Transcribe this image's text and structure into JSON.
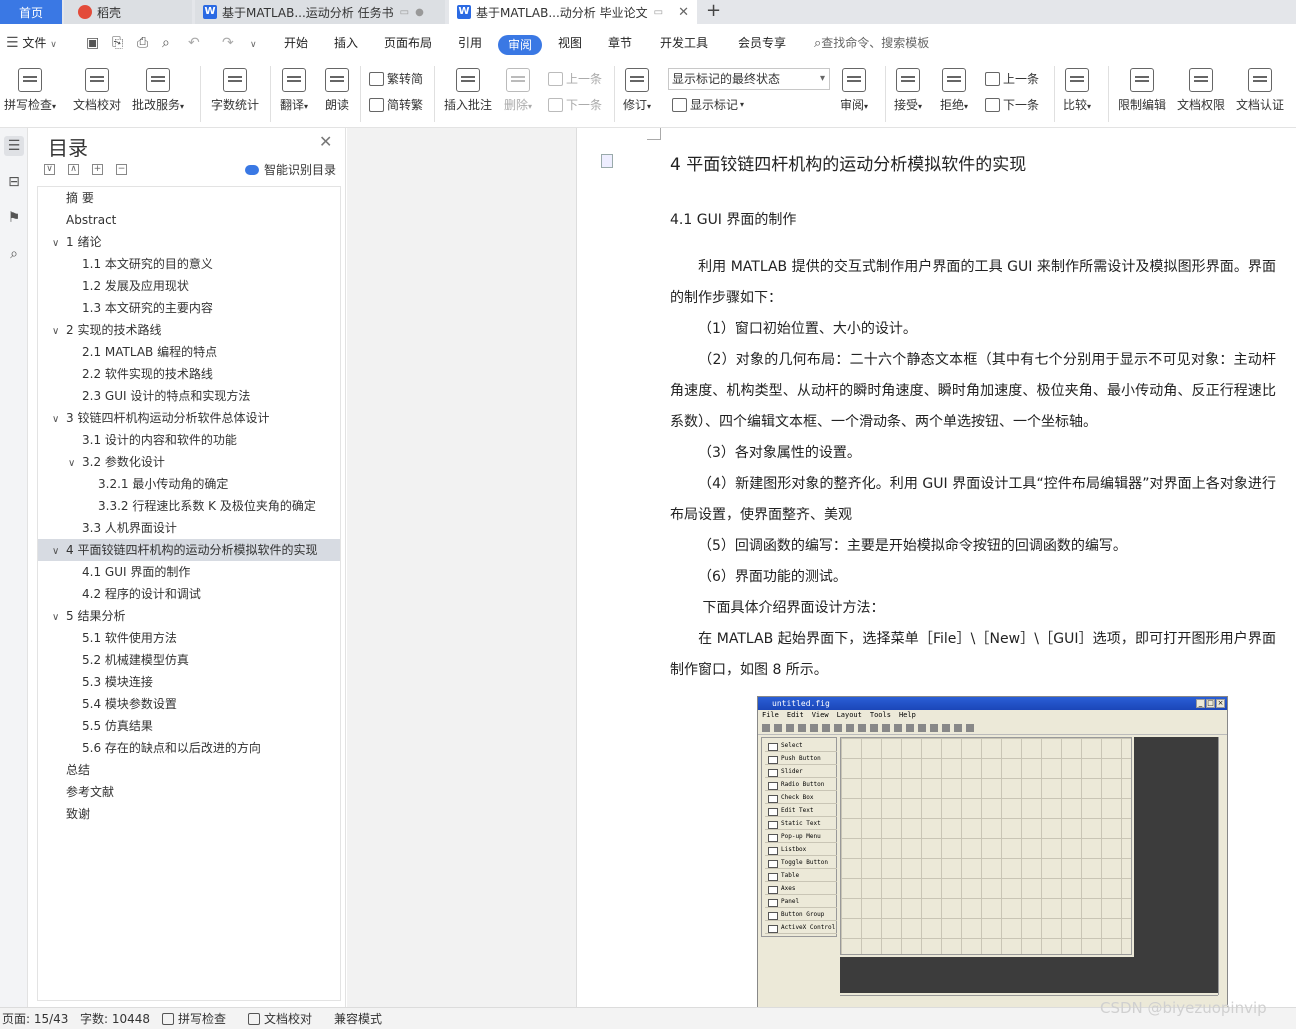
{
  "tabs": {
    "home": "首页",
    "daoke": "稻壳",
    "doc1": "基于MATLAB...运动分析 任务书",
    "doc2": "基于MATLAB...动分析 毕业论文",
    "close": "✕",
    "add": "+"
  },
  "menu": {
    "file": "文件",
    "items": [
      "开始",
      "插入",
      "页面布局",
      "引用",
      "审阅",
      "视图",
      "章节",
      "开发工具",
      "会员专享"
    ],
    "search": "查找命令、搜索模板"
  },
  "ribbon": {
    "spell": "拼写检查",
    "doc_check": "文档校对",
    "batch": "批改服务",
    "word_count": "字数统计",
    "translate": "翻译",
    "read_aloud": "朗读",
    "trad_simp": "繁转简",
    "simp_trad": "简转繁",
    "insert_comment": "插入批注",
    "delete": "删除",
    "prev": "上一条",
    "next": "下一条",
    "revise": "修订",
    "markup_select": "显示标记的最终状态",
    "show_markup": "显示标记",
    "review": "审阅",
    "accept": "接受",
    "reject": "拒绝",
    "prev2": "上一条",
    "next2": "下一条",
    "compare": "比较",
    "restrict": "限制编辑",
    "doc_rights": "文档权限",
    "doc_auth": "文档认证"
  },
  "toc": {
    "title": "目录",
    "close": "✕",
    "smart": "智能识别目录",
    "items": [
      {
        "text": "摘  要",
        "level": "l1"
      },
      {
        "text": "Abstract",
        "level": "l1"
      },
      {
        "text": "1  绪论",
        "level": "l1c",
        "chev": "∨"
      },
      {
        "text": "1.1  本文研究的目的意义",
        "level": "l2"
      },
      {
        "text": "1.2  发展及应用现状",
        "level": "l2"
      },
      {
        "text": "1.3  本文研究的主要内容",
        "level": "l2"
      },
      {
        "text": "2  实现的技术路线",
        "level": "l1c",
        "chev": "∨"
      },
      {
        "text": "2.1 MATLAB 编程的特点",
        "level": "l2"
      },
      {
        "text": "2.2  软件实现的技术路线",
        "level": "l2"
      },
      {
        "text": "2.3 GUI 设计的特点和实现方法",
        "level": "l2"
      },
      {
        "text": "3  铰链四杆机构运动分析软件总体设计",
        "level": "l1c",
        "chev": "∨"
      },
      {
        "text": "3.1  设计的内容和软件的功能",
        "level": "l2"
      },
      {
        "text": "3.2  参数化设计",
        "level": "l2c",
        "chev": "∨"
      },
      {
        "text": "3.2.1  最小传动角的确定",
        "level": "l3"
      },
      {
        "text": "3.3.2  行程速比系数 K 及极位夹角的确定",
        "level": "l3"
      },
      {
        "text": "3.3  人机界面设计",
        "level": "l2"
      },
      {
        "text": "4  平面铰链四杆机构的运动分析模拟软件的实现",
        "level": "l1c",
        "chev": "∨",
        "selected": true
      },
      {
        "text": "4.1 GUI 界面的制作",
        "level": "l2"
      },
      {
        "text": "4.2  程序的设计和调试",
        "level": "l2"
      },
      {
        "text": "5  结果分析",
        "level": "l1c",
        "chev": "∨"
      },
      {
        "text": "5.1 软件使用方法",
        "level": "l2"
      },
      {
        "text": "5.2  机械建模型仿真",
        "level": "l2"
      },
      {
        "text": "5.3  模块连接",
        "level": "l2"
      },
      {
        "text": "5.4  模块参数设置",
        "level": "l2"
      },
      {
        "text": "5.5  仿真结果",
        "level": "l2"
      },
      {
        "text": "5.6  存在的缺点和以后改进的方向",
        "level": "l2"
      },
      {
        "text": "总结",
        "level": "l1"
      },
      {
        "text": "参考文献",
        "level": "l1"
      },
      {
        "text": "致谢",
        "level": "l1"
      }
    ]
  },
  "doc": {
    "h1": "4  平面铰链四杆机构的运动分析模拟软件的实现",
    "h2": "4.1 GUI 界面的制作",
    "paras": [
      "利用 MATLAB 提供的交互式制作用户界面的工具 GUI 来制作所需设计及模拟图形界面。界面的制作步骤如下：",
      "（1）窗口初始位置、大小的设计。",
      "（2）对象的几何布局：二十六个静态文本框（其中有七个分别用于显示不可见对象：主动杆角速度、机构类型、从动杆的瞬时角速度、瞬时角加速度、极位夹角、最小传动角、反正行程速比系数）、四个编辑文本框、一个滑动条、两个单选按钮、一个坐标轴。",
      "（3）各对象属性的设置。",
      "（4）新建图形对象的整齐化。利用 GUI 界面设计工具“控件布局编辑器”对界面上各对象进行布局设置，使界面整齐、美观",
      "（5）回调函数的编写：主要是开始模拟命令按钮的回调函数的编写。",
      "（6）界面功能的测试。",
      " 下面具体介绍界面设计方法：",
      "在 MATLAB 起始界面下，选择菜单［File］\\［New］\\［GUI］选项，即可打开图形用户界面制作窗口，如图 8 所示。"
    ]
  },
  "figure": {
    "title": "untitled.fig",
    "menu": [
      "File",
      "Edit",
      "View",
      "Layout",
      "Tools",
      "Help"
    ],
    "palette": [
      "Select",
      "Push Button",
      "Slider",
      "Radio Button",
      "Check Box",
      "Edit Text",
      "Static Text",
      "Pop-up Menu",
      "Listbox",
      "Toggle Button",
      "Table",
      "Axes",
      "Panel",
      "Button Group",
      "ActiveX Control"
    ]
  },
  "status": {
    "page": "页面: 15/43",
    "words": "字数: 10448",
    "spell": "拼写检查",
    "doc_check": "文档校对",
    "compat": "兼容模式"
  },
  "watermark": "CSDN @biyezuopinvip"
}
